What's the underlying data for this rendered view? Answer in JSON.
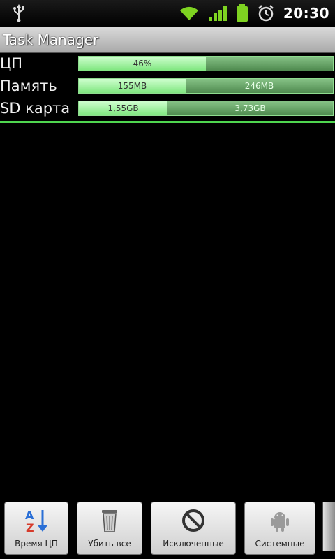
{
  "status_bar": {
    "time": "20:30",
    "icons": [
      "usb-icon",
      "wifi-icon",
      "signal-icon",
      "battery-icon",
      "alarm-icon"
    ]
  },
  "app": {
    "title": "Task Manager"
  },
  "resources": [
    {
      "label": "ЦП",
      "used_text": "46%",
      "free_text": "",
      "used_fraction": 0.5
    },
    {
      "label": "Память",
      "used_text": "155MB",
      "free_text": "246MB",
      "used_fraction": 0.42
    },
    {
      "label": "SD карта",
      "used_text": "1,55GB",
      "free_text": "3,73GB",
      "used_fraction": 0.35
    }
  ],
  "toolbar": {
    "buttons": [
      {
        "label": "Время ЦП",
        "icon": "sort-az-icon"
      },
      {
        "label": "Убить все",
        "icon": "trash-icon"
      },
      {
        "label": "Исключенные",
        "icon": "prohibit-icon"
      },
      {
        "label": "Системные",
        "icon": "android-icon"
      }
    ]
  },
  "colors": {
    "bar_fill": "#a6f5a6",
    "bar_remaining": "#5a9a5a",
    "divider": "#4fd64f",
    "background": "#000000"
  }
}
